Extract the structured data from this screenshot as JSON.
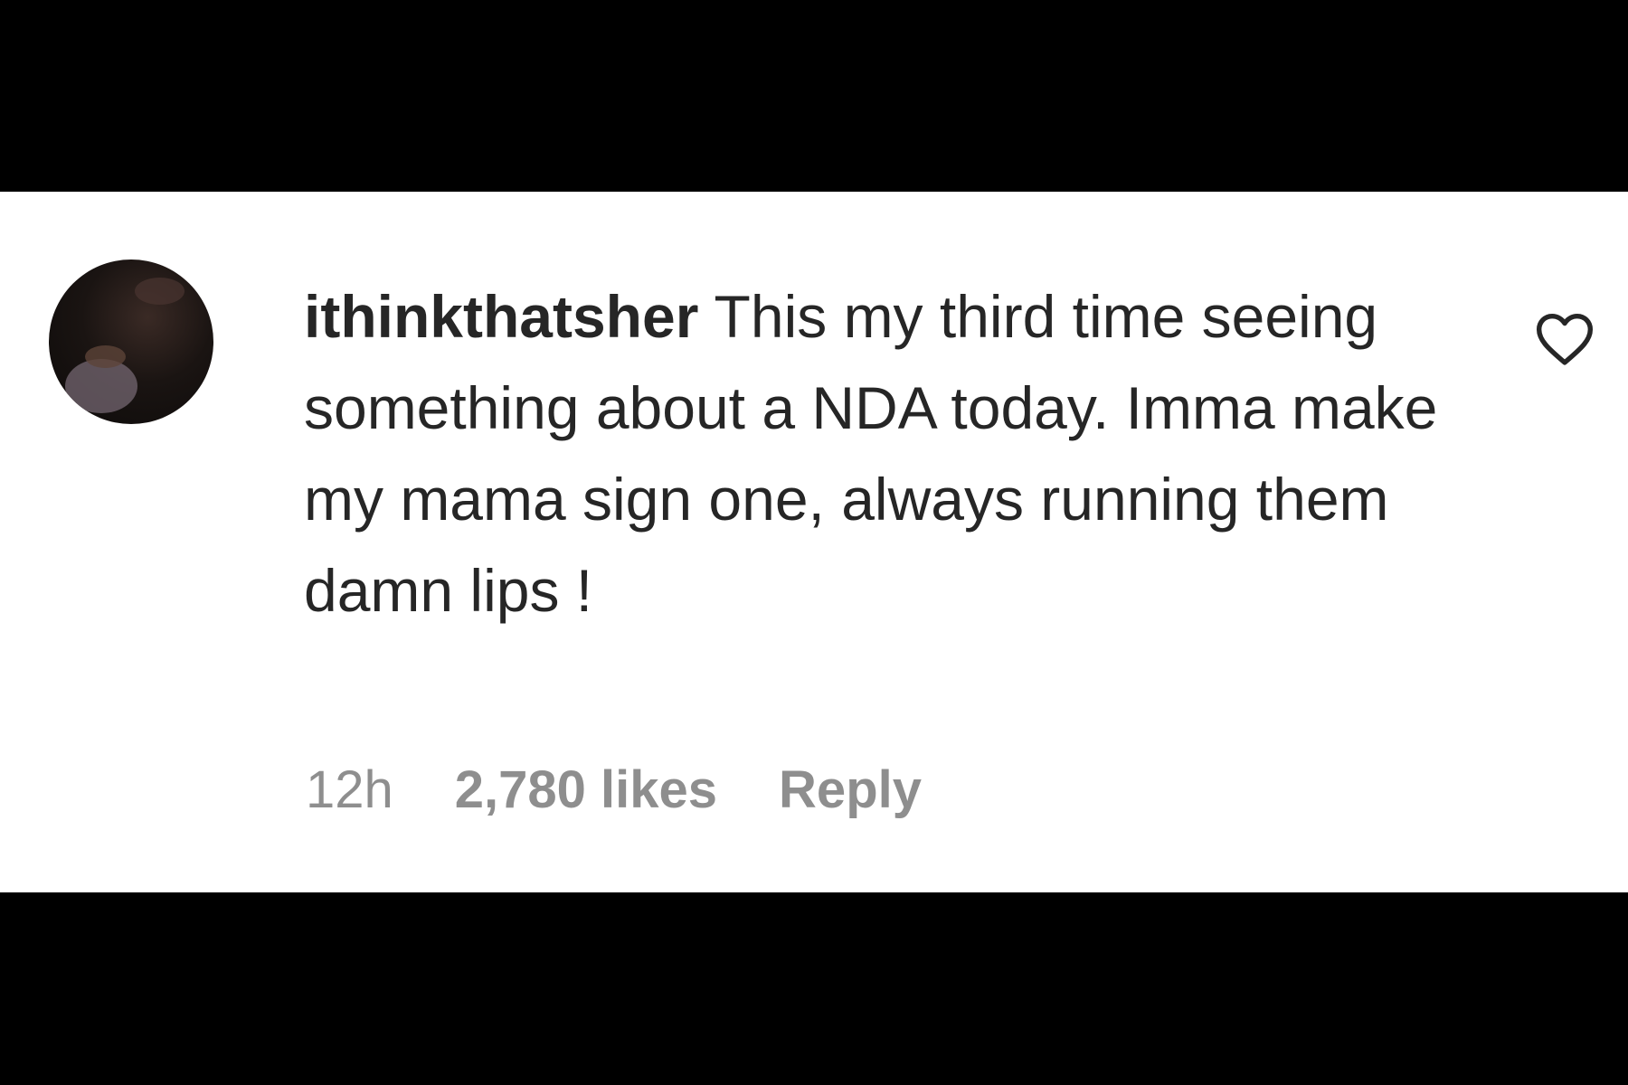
{
  "comment": {
    "username": "ithinkthatsher",
    "text": "This my third time seeing something about a NDA today. Imma make my mama sign one, always running them damn lips !",
    "timestamp": "12h",
    "likes": "2,780 likes",
    "reply_label": "Reply"
  },
  "icons": {
    "like": "heart-outline-icon"
  },
  "colors": {
    "background_bars": "#000000",
    "panel": "#ffffff",
    "text": "#262626",
    "meta": "#8e8e8e"
  }
}
